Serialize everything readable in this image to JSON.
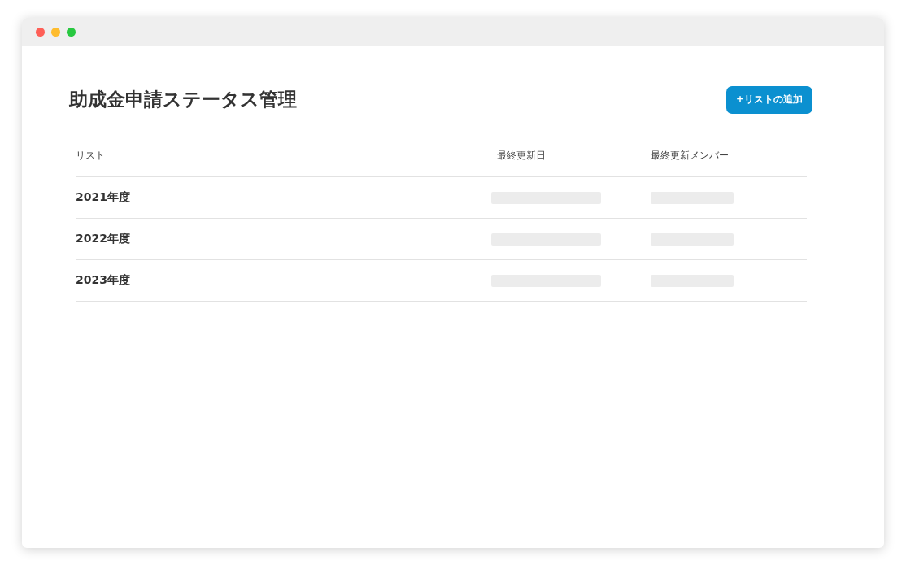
{
  "page": {
    "title": "助成金申請ステータス管理",
    "add_button": "+リストの追加"
  },
  "table": {
    "columns": [
      "リスト",
      "最終更新日",
      "最終更新メンバー"
    ],
    "rows": [
      {
        "name": "2021年度"
      },
      {
        "name": "2022年度"
      },
      {
        "name": "2023年度"
      }
    ]
  }
}
